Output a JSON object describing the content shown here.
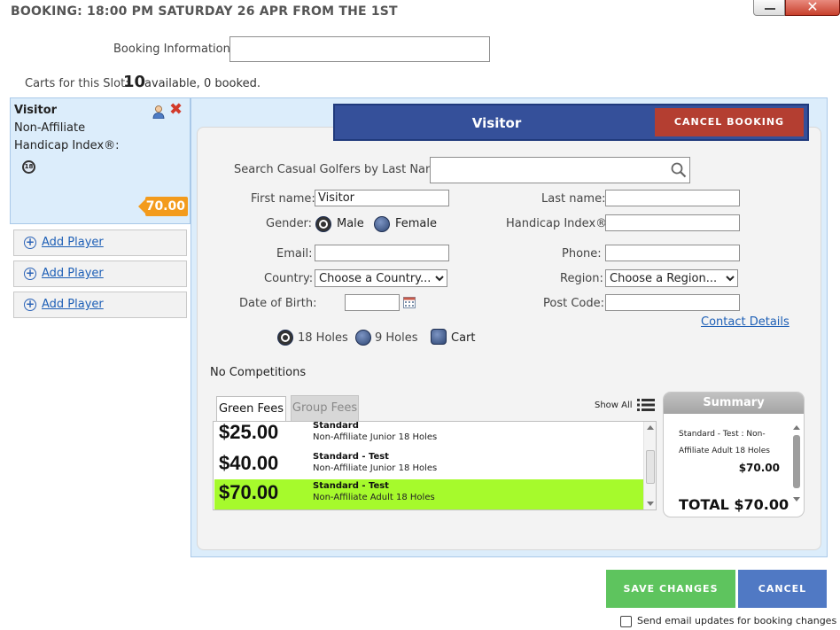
{
  "header": {
    "title": "BOOKING: 18:00 PM SATURDAY 26 APR FROM THE 1ST"
  },
  "booking_info": {
    "label": "Booking Information:",
    "value": ""
  },
  "carts": {
    "label": "Carts for this Slot:",
    "count": "10",
    "rest": "available, 0 booked."
  },
  "player": {
    "name": "Visitor",
    "affiliation": "Non-Affiliate",
    "handicap_label": "Handicap Index®:",
    "badge": "18",
    "price": "70.00"
  },
  "add_player": [
    "Add Player",
    "Add Player",
    "Add Player"
  ],
  "form": {
    "title": "Visitor",
    "cancel_booking": "CANCEL BOOKING",
    "search_label": "Search Casual Golfers by Last Name:",
    "search_value": "",
    "first_name_label": "First name:",
    "first_name_value": "Visitor",
    "last_name_label": "Last name:",
    "last_name_value": "",
    "gender_label": "Gender:",
    "gender_male": "Male",
    "gender_female": "Female",
    "handicap_label": "Handicap Index®:",
    "handicap_value": "",
    "email_label": "Email:",
    "email_value": "",
    "phone_label": "Phone:",
    "phone_value": "",
    "country_label": "Country:",
    "country_selected": "Choose a Country...",
    "region_label": "Region:",
    "region_selected": "Choose a Region...",
    "dob_label": "Date of Birth:",
    "dob_value": "",
    "postcode_label": "Post Code:",
    "postcode_value": "",
    "contact_details": "Contact Details",
    "holes_18": "18 Holes",
    "holes_9": "9 Holes",
    "cart": "Cart",
    "competitions": "No Competitions"
  },
  "fees": {
    "tab_green": "Green Fees",
    "tab_group": "Group Fees",
    "show_all": "Show All",
    "rows": [
      {
        "price": "$25.00",
        "name": "Standard",
        "desc": "Non-Affiliate Junior 18 Holes"
      },
      {
        "price": "$40.00",
        "name": "Standard - Test",
        "desc": "Non-Affiliate Junior 18 Holes"
      },
      {
        "price": "$70.00",
        "name": "Standard - Test",
        "desc": "Non-Affiliate Adult 18 Holes"
      }
    ]
  },
  "summary": {
    "title": "Summary",
    "line1": "Standard - Test : Non-Affiliate Adult 18 Holes",
    "price": "$70.00",
    "total": "TOTAL $70.00"
  },
  "footer": {
    "save": "SAVE CHANGES",
    "cancel": "CANCEL",
    "email_updates": "Send email updates for booking changes"
  },
  "colors": {
    "selected_row": "#a6fa2c",
    "save_button": "#5ec45e",
    "cancel_button": "#5079c4",
    "cancel_booking": "#b43e31",
    "visitor_bar": "#35509a",
    "price_tag": "#f39b1c"
  }
}
